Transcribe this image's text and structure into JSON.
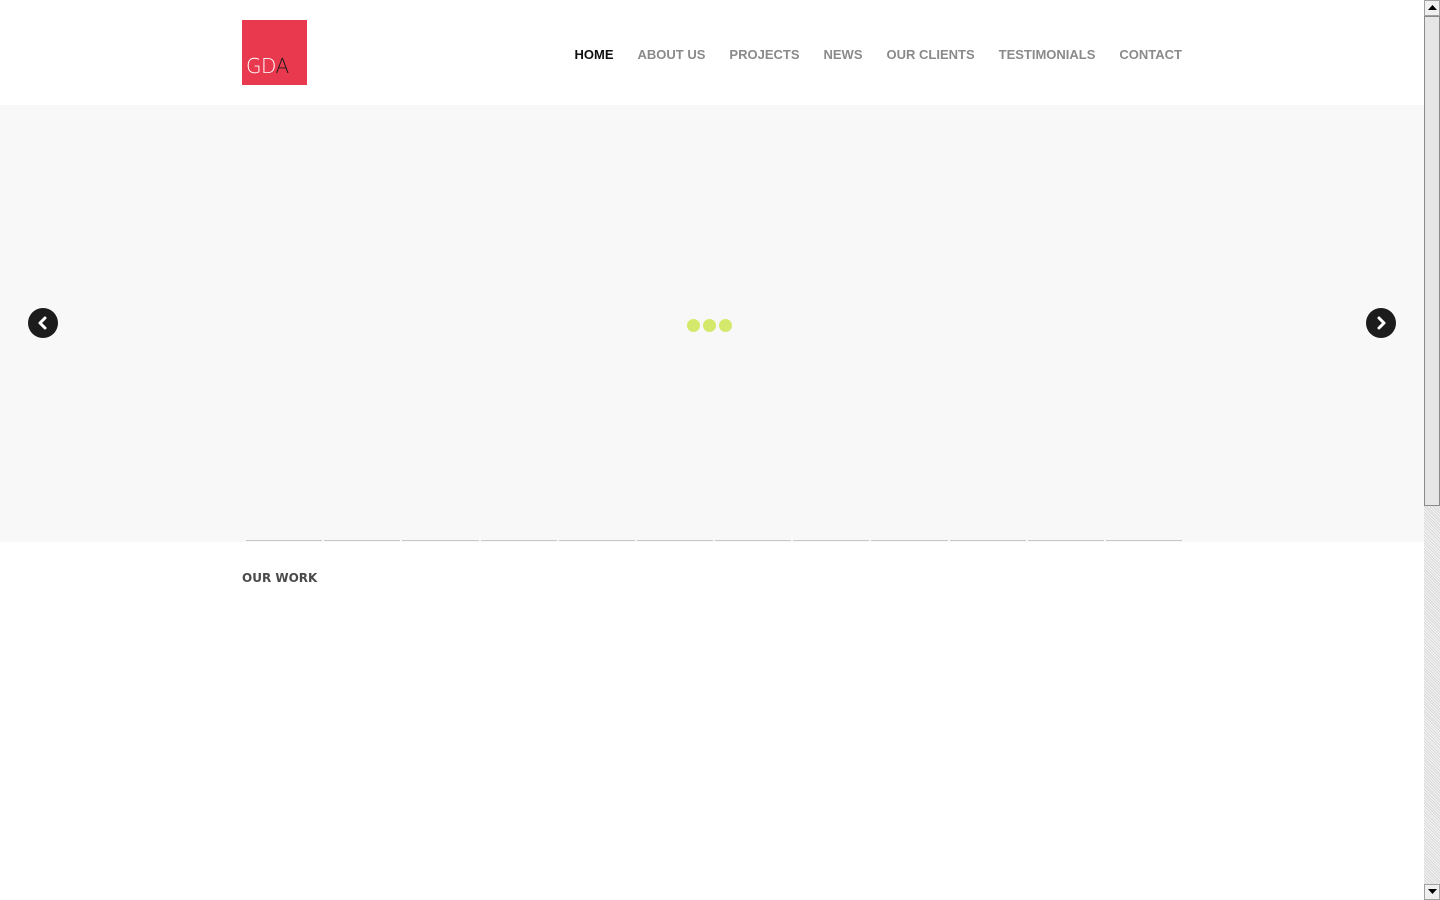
{
  "logo": {
    "text_gd": "GD",
    "text_a": "A",
    "color": "#e8394f"
  },
  "nav": {
    "items": [
      {
        "label": "HOME",
        "active": true
      },
      {
        "label": "ABOUT US",
        "active": false
      },
      {
        "label": "PROJECTS",
        "active": false
      },
      {
        "label": "NEWS",
        "active": false
      },
      {
        "label": "OUR CLIENTS",
        "active": false
      },
      {
        "label": "TESTIMONIALS",
        "active": false
      },
      {
        "label": "CONTACT",
        "active": false
      }
    ]
  },
  "slider": {
    "prev_icon": "chevron-left-icon",
    "next_icon": "chevron-right-icon",
    "loader_color": "#d4e86c",
    "thumbnail_count": 12
  },
  "section": {
    "title": "OUR WORK"
  },
  "colors": {
    "accent": "#e8394f",
    "nav_active": "#111111",
    "nav_inactive": "#8a8a8a",
    "slider_bg": "#f8f8f8"
  }
}
